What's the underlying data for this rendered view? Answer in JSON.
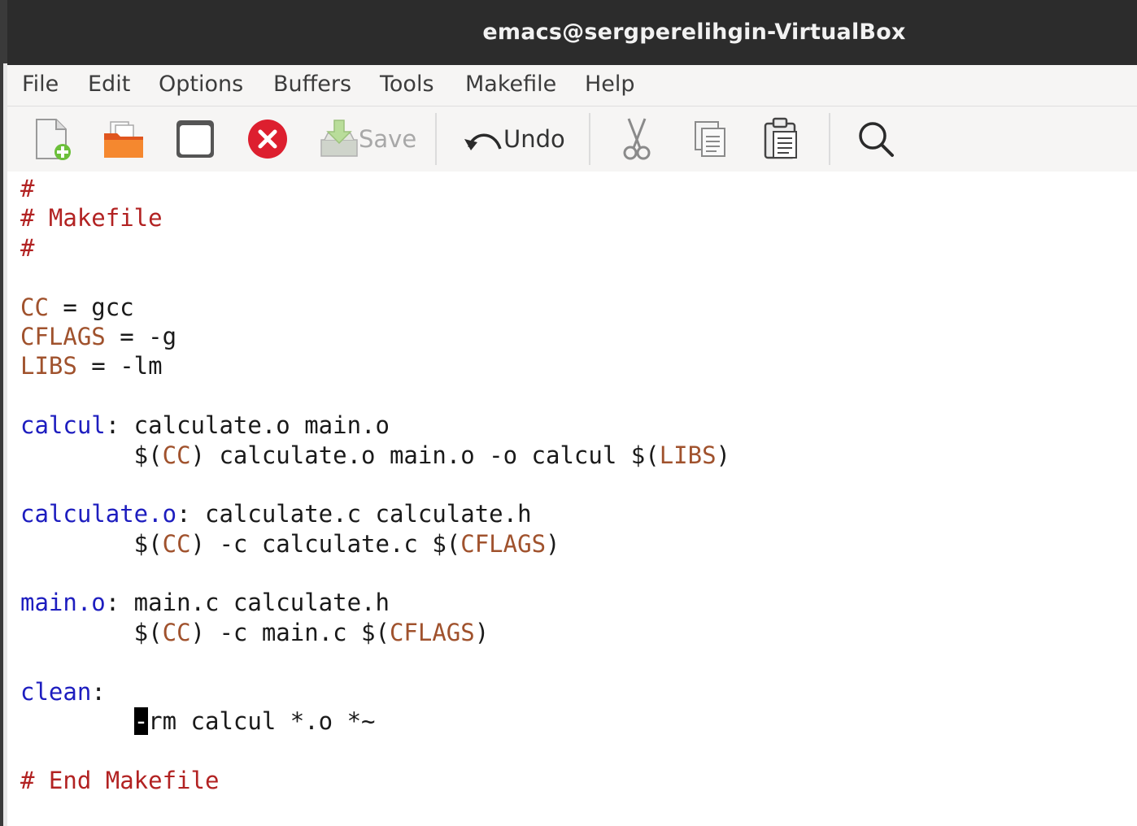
{
  "window": {
    "title": "emacs@sergperelihgin-VirtualBox"
  },
  "menu": {
    "items": [
      "File",
      "Edit",
      "Options",
      "Buffers",
      "Tools",
      "Makefile",
      "Help"
    ]
  },
  "toolbar": {
    "new_file_icon": "new-file-icon",
    "open_icon": "open-folder-icon",
    "dired_icon": "directory-icon",
    "close_icon": "close-buffer-icon",
    "save_label": "Save",
    "undo_label": "Undo",
    "cut_icon": "scissors-icon",
    "copy_icon": "copy-icon",
    "paste_icon": "paste-icon",
    "search_icon": "search-icon"
  },
  "editor": {
    "lines": [
      [
        {
          "t": "#",
          "k": "cm"
        }
      ],
      [
        {
          "t": "# Makefile",
          "k": "cm"
        }
      ],
      [
        {
          "t": "#",
          "k": "cm"
        }
      ],
      [],
      [
        {
          "t": "CC",
          "k": "var"
        },
        {
          "t": " = gcc",
          "k": ""
        }
      ],
      [
        {
          "t": "CFLAGS",
          "k": "var"
        },
        {
          "t": " = -g",
          "k": ""
        }
      ],
      [
        {
          "t": "LIBS",
          "k": "var"
        },
        {
          "t": " = -lm",
          "k": ""
        }
      ],
      [],
      [
        {
          "t": "calcul",
          "k": "tgt"
        },
        {
          "t": ": calculate.o main.o",
          "k": ""
        }
      ],
      [
        {
          "t": "\t$(",
          "k": ""
        },
        {
          "t": "CC",
          "k": "var"
        },
        {
          "t": ") calculate.o main.o -o calcul $(",
          "k": ""
        },
        {
          "t": "LIBS",
          "k": "var"
        },
        {
          "t": ")",
          "k": ""
        }
      ],
      [],
      [
        {
          "t": "calculate.o",
          "k": "tgt"
        },
        {
          "t": ": calculate.c calculate.h",
          "k": ""
        }
      ],
      [
        {
          "t": "\t$(",
          "k": ""
        },
        {
          "t": "CC",
          "k": "var"
        },
        {
          "t": ") -c calculate.c $(",
          "k": ""
        },
        {
          "t": "CFLAGS",
          "k": "var"
        },
        {
          "t": ")",
          "k": ""
        }
      ],
      [],
      [
        {
          "t": "main.o",
          "k": "tgt"
        },
        {
          "t": ": main.c calculate.h",
          "k": ""
        }
      ],
      [
        {
          "t": "\t$(",
          "k": ""
        },
        {
          "t": "CC",
          "k": "var"
        },
        {
          "t": ") -c main.c $(",
          "k": ""
        },
        {
          "t": "CFLAGS",
          "k": "var"
        },
        {
          "t": ")",
          "k": ""
        }
      ],
      [],
      [
        {
          "t": "clean",
          "k": "tgt"
        },
        {
          "t": ":",
          "k": ""
        }
      ],
      [
        {
          "t": "\t",
          "k": ""
        },
        {
          "t": "-",
          "k": "cursor"
        },
        {
          "t": "rm calcul *.o *~",
          "k": ""
        }
      ],
      [],
      [
        {
          "t": "# End Makefile",
          "k": "cm"
        }
      ]
    ]
  }
}
